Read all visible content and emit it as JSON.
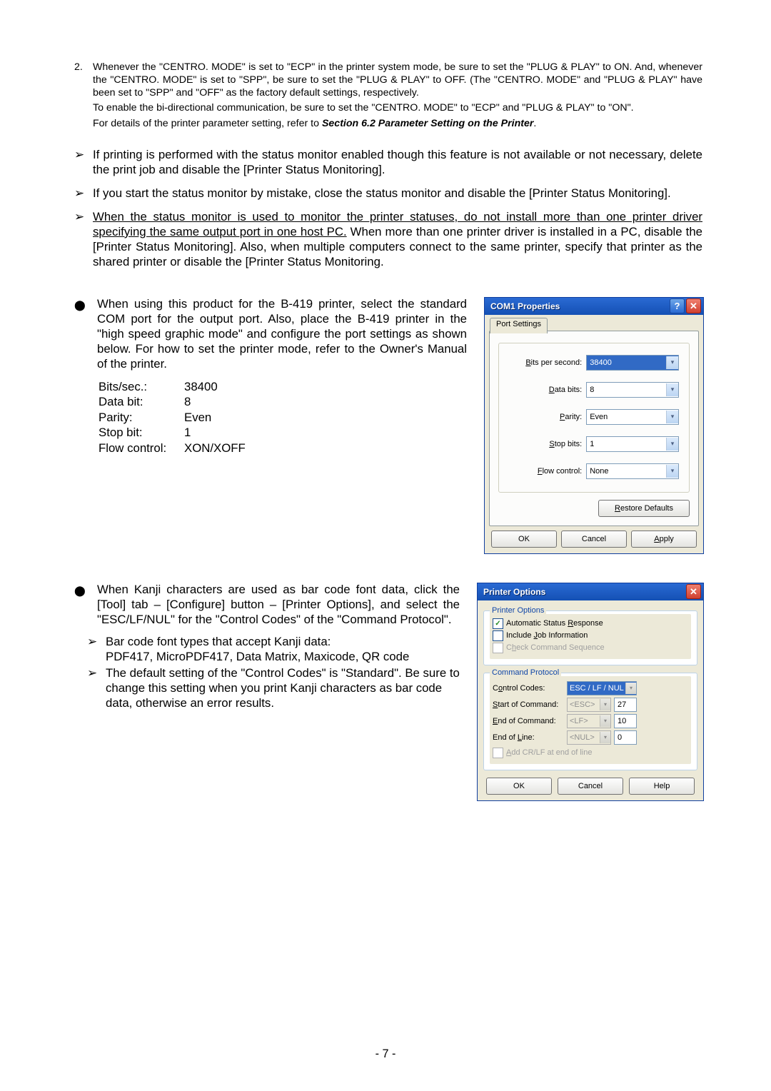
{
  "ol2": {
    "num": "2.",
    "p1": "Whenever the \"CENTRO. MODE\" is set to \"ECP\" in the printer system mode, be sure to set the \"PLUG & PLAY\" to ON.  And, whenever the \"CENTRO. MODE\" is set to \"SPP\", be sure to set the \"PLUG & PLAY\" to OFF.  (The \"CENTRO. MODE\" and \"PLUG & PLAY\" have been set to \"SPP\" and \"OFF\" as the factory default settings, respectively.",
    "p2": "To enable the bi-directional communication, be sure to set the \"CENTRO. MODE\" to \"ECP\" and \"PLUG & PLAY\" to \"ON\".",
    "p3_prefix": "For details of the printer parameter setting, refer to ",
    "p3_section": "Section 6.2 Parameter Setting on the Printer",
    "p3_suffix": "."
  },
  "chev": {
    "a": "If printing is performed with the status monitor enabled though this feature is not available or not necessary, delete the print job and disable the [Printer Status Monitoring].",
    "b": "If you start the status monitor by mistake, close the status monitor and disable the [Printer Status Monitoring].",
    "c_u": "When the status monitor is used to monitor the printer statuses, do not install more than one printer driver specifying the same output port in one host PC.",
    "c_rest": "   When more than one printer driver is installed in a PC, disable the [Printer Status Monitoring].  Also, when multiple computers connect to the same printer, specify that printer as the shared printer or disable the [Printer Status Monitoring."
  },
  "bullet_com": "When using this product for the B-419 printer, select the standard COM port for the output port.  Also, place the B-419 printer in the \"high speed graphic mode\" and configure the port settings as shown below.   For how to set the printer mode, refer to the Owner's Manual of the printer.",
  "portset": {
    "bits_sec_k": "Bits/sec.:",
    "bits_sec_v": "38400",
    "data_bit_k": "Data bit:",
    "data_bit_v": "8",
    "parity_k": "Parity:",
    "parity_v": "Even",
    "stop_bit_k": "Stop bit:",
    "stop_bit_v": "1",
    "flow_k": "Flow control:",
    "flow_v": "XON/XOFF"
  },
  "dlg1": {
    "title": "COM1 Properties",
    "tab": "Port Settings",
    "bps_lbl": "Bits per second:",
    "bps_val": "38400",
    "data_lbl": "Data bits:",
    "data_val": "8",
    "parity_lbl": "Parity:",
    "parity_val": "Even",
    "stop_lbl": "Stop bits:",
    "stop_val": "1",
    "flow_lbl": "Flow control:",
    "flow_val": "None",
    "restore": "Restore Defaults",
    "ok": "OK",
    "cancel": "Cancel",
    "apply": "Apply"
  },
  "bullet_kanji": "When Kanji characters are used as bar code font data, click the [Tool] tab – [Configure] button – [Printer Options], and select the \"ESC/LF/NUL\" for the \"Control Codes\" of the \"Command Protocol\".",
  "kanji_sub": {
    "a_l1": "Bar code font types that accept Kanji data:",
    "a_l2": "PDF417, MicroPDF417, Data Matrix, Maxicode, QR code",
    "b": "The default setting of the \"Control Codes\" is \"Standard\".   Be sure to change this setting when you print Kanji characters as bar code data, otherwise an error results."
  },
  "dlg2": {
    "title": "Printer Options",
    "grp1_legend": "Printer Options",
    "asr": "Automatic Status Response",
    "iji": "Include Job Information",
    "ccs": "Check Command Sequence",
    "grp2_legend": "Command Protocol",
    "cc_lbl": "Control Codes:",
    "cc_val": "ESC / LF / NUL",
    "sc_lbl": "Start of Command:",
    "sc_sel": "<ESC>",
    "sc_num": "27",
    "ec_lbl": "End of Command:",
    "ec_sel": "<LF>",
    "ec_num": "10",
    "el_lbl": "End of Line:",
    "el_sel": "<NUL>",
    "el_num": "0",
    "addcr": "Add CR/LF at end of line",
    "ok": "OK",
    "cancel": "Cancel",
    "help": "Help"
  },
  "pagenum": "- 7 -"
}
